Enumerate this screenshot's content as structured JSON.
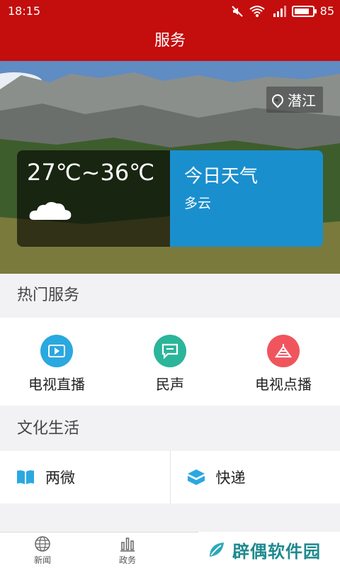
{
  "status_bar": {
    "time": "18:15",
    "battery": "85",
    "battery_level": 0.85
  },
  "header": {
    "title": "服务"
  },
  "weather": {
    "location": "潜江",
    "temperature": "27℃~36℃",
    "today_label": "今日天气",
    "condition": "多云"
  },
  "hot_services": {
    "title": "热门服务",
    "items": [
      {
        "label": "电视直播",
        "icon": "tv-play-icon",
        "color": "#2aa8e0"
      },
      {
        "label": "民声",
        "icon": "chat-icon",
        "color": "#2bb59a"
      },
      {
        "label": "电视点播",
        "icon": "broadcast-icon",
        "color": "#f0555e"
      }
    ]
  },
  "culture": {
    "title": "文化生活",
    "items": [
      {
        "label": "两微",
        "icon": "book-icon",
        "color": "#2aa8e0"
      },
      {
        "label": "快递",
        "icon": "package-icon",
        "color": "#2aa8e0"
      }
    ]
  },
  "tabbar": {
    "items": [
      {
        "label": "新闻",
        "icon": "globe-icon"
      },
      {
        "label": "政务",
        "icon": "bar-chart-icon"
      }
    ]
  },
  "watermark": {
    "text": "辟偶软件园"
  }
}
